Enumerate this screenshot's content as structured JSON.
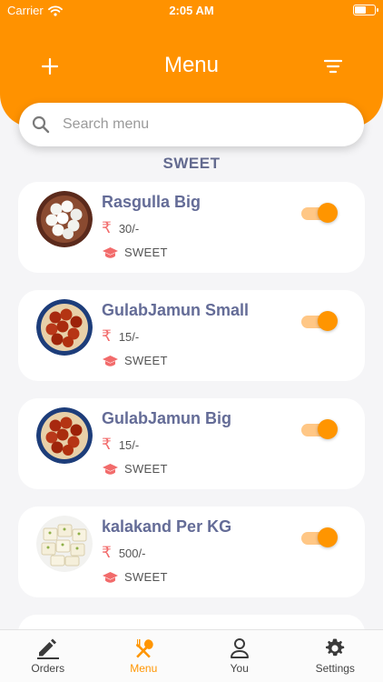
{
  "status": {
    "carrier": "Carrier",
    "time": "2:05 AM"
  },
  "header": {
    "title": "Menu"
  },
  "search": {
    "placeholder": "Search menu"
  },
  "section": {
    "title": "SWEET"
  },
  "items": [
    {
      "name": "Rasgulla Big",
      "price": "30/-",
      "category": "SWEET",
      "image": "rasgulla",
      "enabled": true
    },
    {
      "name": "GulabJamun Small",
      "price": "15/-",
      "category": "SWEET",
      "image": "gulabjamun",
      "enabled": true
    },
    {
      "name": "GulabJamun Big",
      "price": "15/-",
      "category": "SWEET",
      "image": "gulabjamun",
      "enabled": true
    },
    {
      "name": "kalakand Per KG",
      "price": "500/-",
      "category": "SWEET",
      "image": "kalakand",
      "enabled": true
    }
  ],
  "tabs": [
    {
      "label": "Orders",
      "icon": "pencil-icon"
    },
    {
      "label": "Menu",
      "icon": "fork-spoon-icon",
      "active": true
    },
    {
      "label": "You",
      "icon": "person-icon"
    },
    {
      "label": "Settings",
      "icon": "gear-icon"
    }
  ],
  "colors": {
    "accent": "#ff9200",
    "title": "#646c97",
    "rupee": "#f26b6b"
  }
}
